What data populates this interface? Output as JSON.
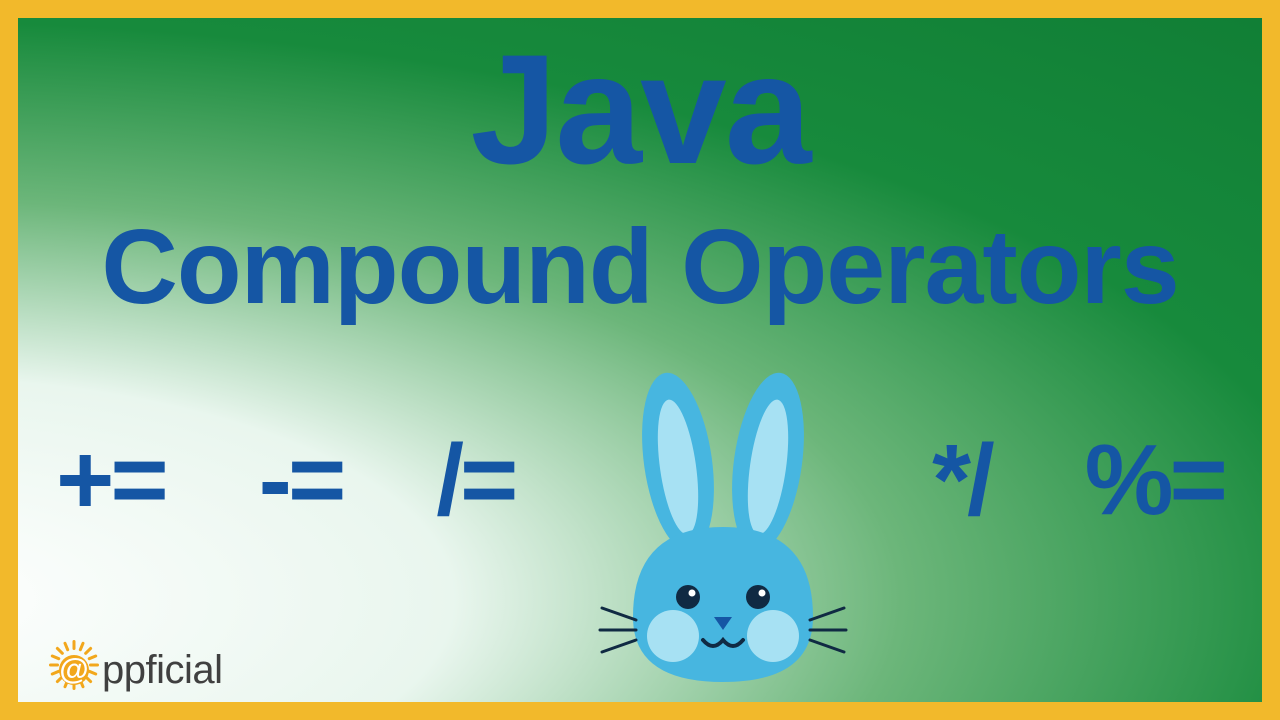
{
  "title": "Java",
  "subtitle": "Compound Operators",
  "operators": {
    "op1": "+=",
    "op2": "-=",
    "op3": "/=",
    "op4": "*/",
    "op5": "%="
  },
  "logo": {
    "at_symbol": "@",
    "text": "ppficial"
  },
  "colors": {
    "border": "#f2b92b",
    "text": "#1556a4",
    "logo_sun": "#f2a71c",
    "logo_text": "#404040",
    "rabbit_body": "#47b6e0",
    "rabbit_inner": "#a7e1f3",
    "rabbit_nose": "#1556a4"
  }
}
